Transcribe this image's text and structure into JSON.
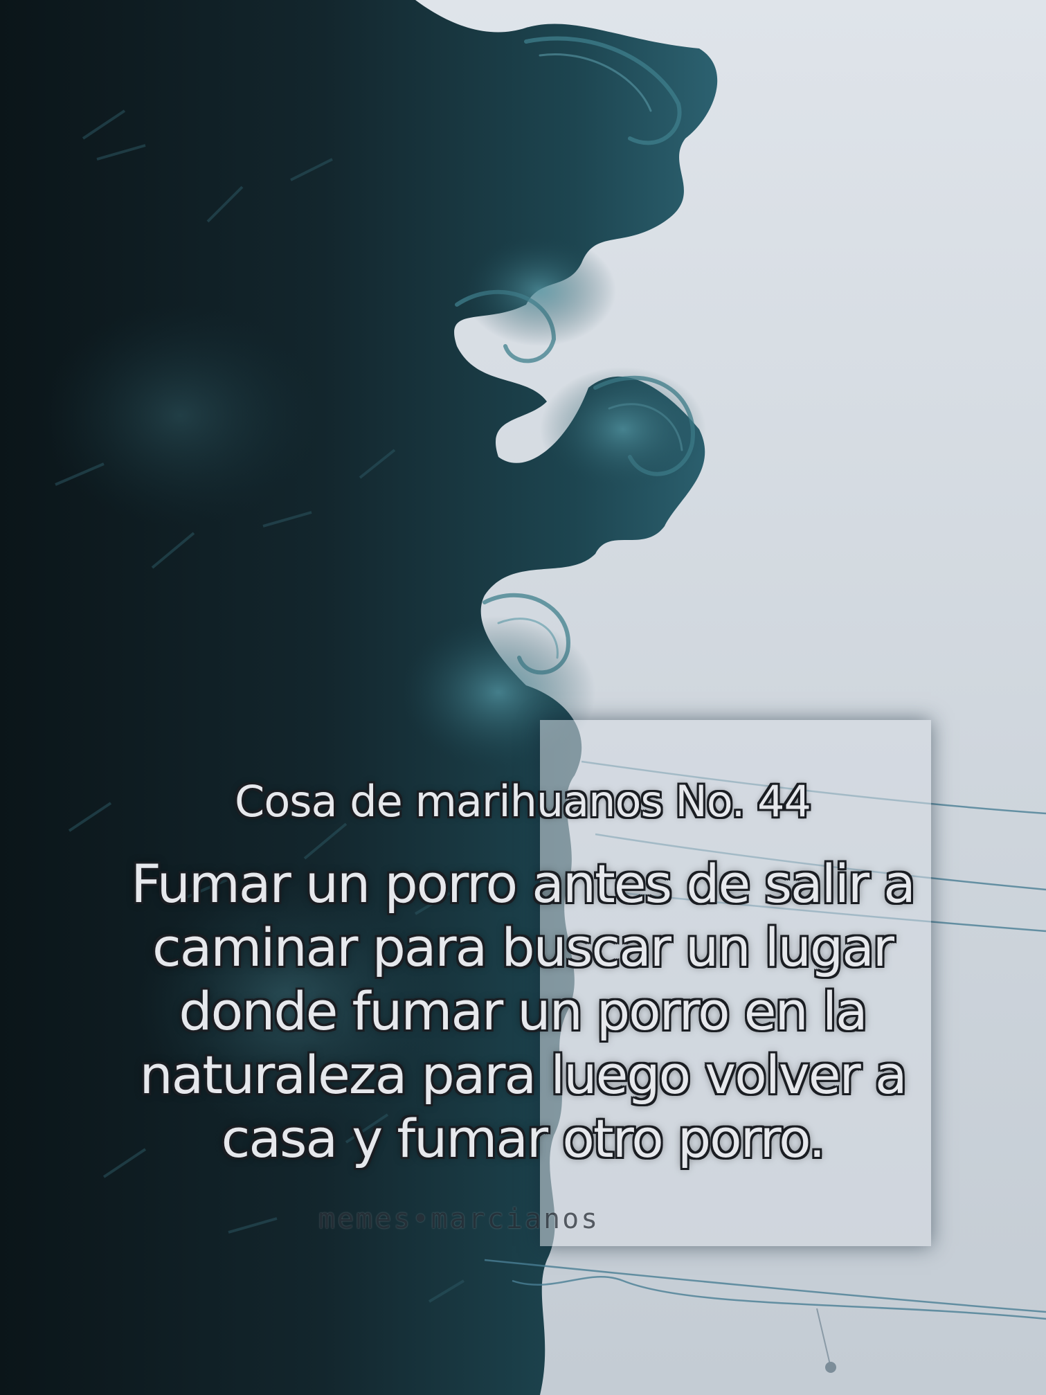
{
  "meme": {
    "title": "Cosa de marihuanos No. 44",
    "body": "Fumar un porro antes de salir a caminar para buscar un lugar donde fumar un porro en la naturaleza para luego volver a casa y fumar otro porro.",
    "watermark": "memes•marcianos"
  },
  "colors": {
    "sky": "#dfe4ea",
    "foliage_dark": "#0f1e26",
    "foliage_teal": "#2f6b78",
    "text_fill": "#e6e8ec",
    "text_outline": "#1a1d22"
  }
}
